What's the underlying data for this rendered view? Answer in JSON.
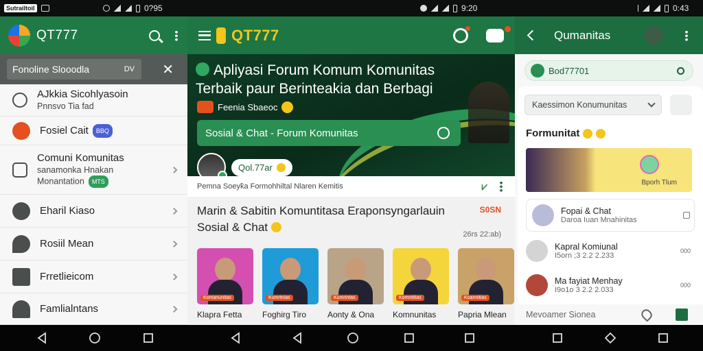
{
  "status": {
    "left": {
      "carrier_chip": "Sutrailtoil",
      "time": "0?95"
    },
    "middle": {
      "time": "9:20"
    },
    "right": {
      "time": "0:43"
    }
  },
  "drawer": {
    "app_title": "QT777",
    "search_placeholder": "Fonoline Slooodla",
    "search_tag": "DV",
    "items": [
      {
        "label": "AJkkia Sicohlyasoin",
        "sub": "Pnnsvo Tia fad",
        "icon": "chat-bubble-icon",
        "badge": ""
      },
      {
        "label": "Fosiel Cait",
        "sub": "",
        "icon": "orange-avatar-icon",
        "badge": "BBQ"
      },
      {
        "label": "Comuni Komunitas",
        "sub": "sanamonka Hnakan",
        "sub2": "Monantation",
        "icon": "home-icon",
        "badge": "MTS"
      },
      {
        "label": "Eharil Kiaso",
        "sub": "",
        "icon": "gauge-icon",
        "badge": ""
      },
      {
        "label": "Rosiil Mean",
        "sub": "",
        "icon": "rocket-icon",
        "badge": ""
      },
      {
        "label": "Frretlieicom",
        "sub": "",
        "icon": "bag-icon",
        "badge": ""
      },
      {
        "label": "Famlialntans",
        "sub": "",
        "icon": "people-icon",
        "badge": ""
      }
    ]
  },
  "forum": {
    "app_title": "QT777",
    "hero_title": "Apliyasi Forum Komum Komunitas Terbaik paur Berinteakia dan Berbagi",
    "hero_sub": "Feenia Sbaeoc",
    "hero_button": "Sosial & Chat - Forum Komunitas",
    "user_name": "Qol.77ar",
    "meta_text": "Pemna Soeyk̄a Formohhiltal Nlaren Kemitis",
    "section_title": "Marin & Sabitin Komuntitasa Eraponsyngarlauin",
    "section_sub": "Sosial & Chat",
    "see_all": "S0SN",
    "section_date": "26rs 22:ab)",
    "cards": [
      {
        "caption": "Klapra Fetta",
        "tag": "Komanunitas",
        "bg": "#d44fb0"
      },
      {
        "caption": "Foghirg Tiro",
        "tag": "Kumrtnias",
        "bg": "#1f9bd8"
      },
      {
        "caption": "Aonty & Ona",
        "tag": "Kumrintas",
        "bg": "#b9a488"
      },
      {
        "caption": "Komnunitas",
        "tag": "Komntitias",
        "bg": "#f5d53c"
      },
      {
        "caption": "Papria Mlean",
        "tag": "Koannitias",
        "bg": "#c9a26a"
      }
    ]
  },
  "community": {
    "title": "Qumanitas",
    "search_value": "Bod77701",
    "filter_label": "Kaessimon Konumunitas",
    "heading": "Formunitat",
    "banner_label": "Bporh Tlum",
    "rows": [
      {
        "name": "Fopai & Chat",
        "sub": "Daroa Iuan Mnahinitas",
        "side": "",
        "av_color": "#b8bcd8"
      },
      {
        "name": "Kapral Komiunal",
        "sub": "I5orn ;3 2.2 2.233",
        "side": "000",
        "av_color": "#d4d4d4"
      },
      {
        "name": "Ma fayiat Menhay",
        "sub": "I9o1o 3 2.2 2.033",
        "side": "000",
        "av_color": "#b1483a"
      }
    ],
    "bottom_label": "Mevoamer Sionea"
  }
}
